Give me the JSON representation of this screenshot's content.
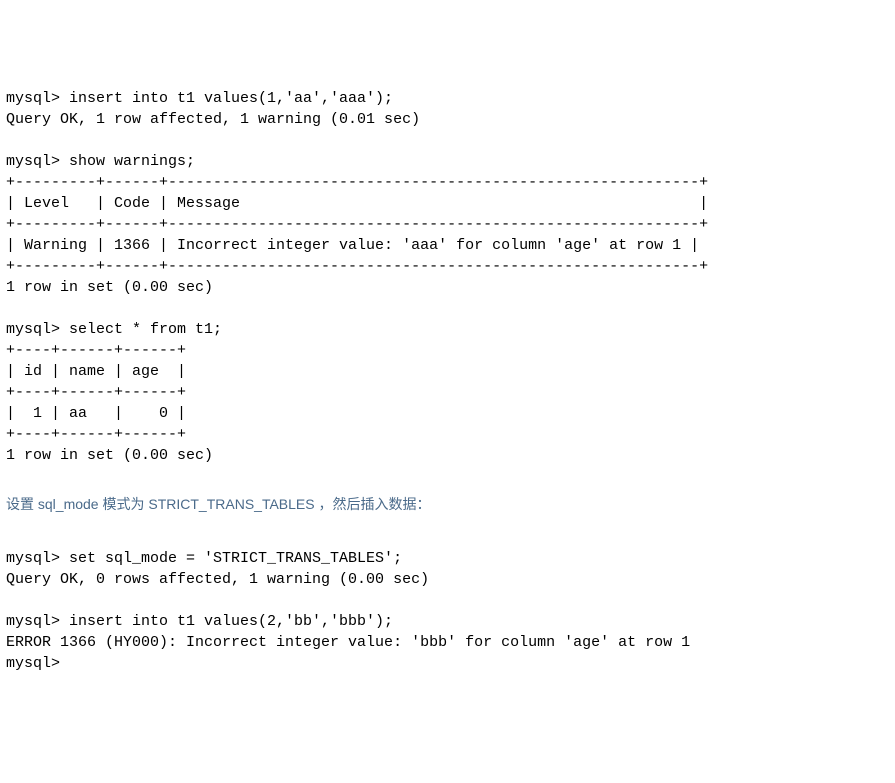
{
  "block1": {
    "cmd": "mysql> insert into t1 values(1,'aa','aaa');",
    "resp": "Query OK, 1 row affected, 1 warning (0.01 sec)"
  },
  "block2": {
    "cmd": "mysql> show warnings;",
    "sep_top": "+---------+------+-----------------------------------------------------------+",
    "header": "| Level   | Code | Message                                                   |",
    "sep_mid": "+---------+------+-----------------------------------------------------------+",
    "row": "| Warning | 1366 | Incorrect integer value: 'aaa' for column 'age' at row 1 |",
    "sep_bot": "+---------+------+-----------------------------------------------------------+",
    "footer": "1 row in set (0.00 sec)"
  },
  "block3": {
    "cmd": "mysql> select * from t1;",
    "sep_top": "+----+------+------+",
    "header": "| id | name | age  |",
    "sep_mid": "+----+------+------+",
    "row": "|  1 | aa   |    0 |",
    "sep_bot": "+----+------+------+",
    "footer": "1 row in set (0.00 sec)"
  },
  "annotation": {
    "text": "设置 sql_mode 模式为 STRICT_TRANS_TABLES ，然后插入数据："
  },
  "block4": {
    "cmd": "mysql> set sql_mode = 'STRICT_TRANS_TABLES';",
    "resp": "Query OK, 0 rows affected, 1 warning (0.00 sec)"
  },
  "block5": {
    "cmd": "mysql> insert into t1 values(2,'bb','bbb');",
    "err": "ERROR 1366 (HY000): Incorrect integer value: 'bbb' for column 'age' at row 1",
    "prompt": "mysql>"
  }
}
